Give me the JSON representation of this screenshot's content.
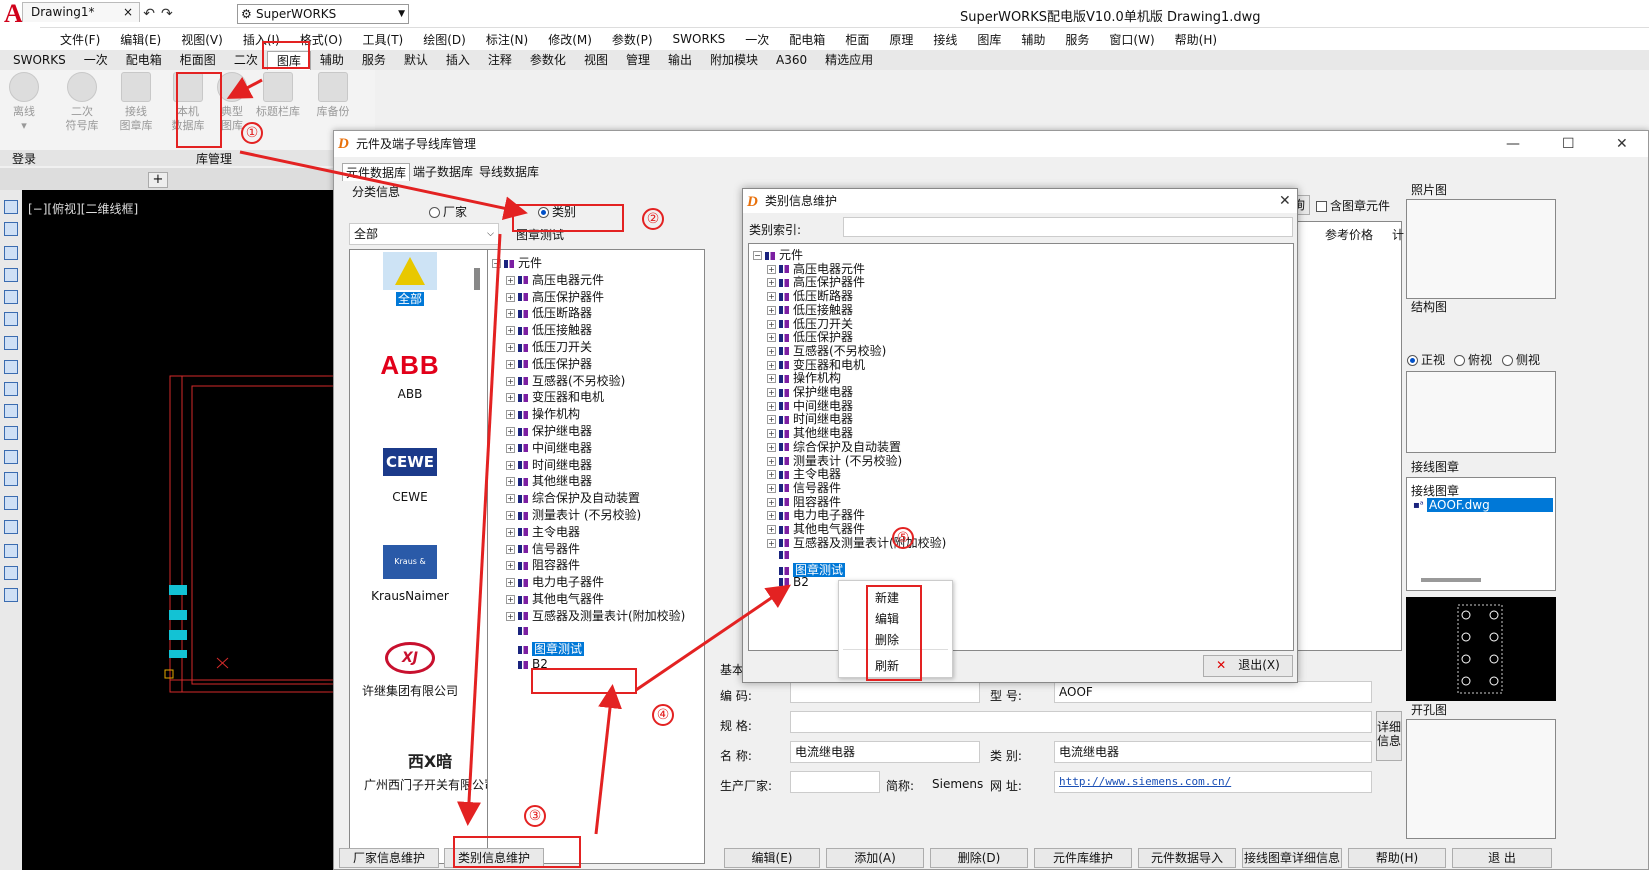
{
  "app": {
    "title": "SuperWORKS配电版V10.0单机版   Drawing1.dwg",
    "workspace": "SuperWORKS",
    "logo_letter": "A"
  },
  "menubar": [
    "文件(F)",
    "编辑(E)",
    "视图(V)",
    "插入(I)",
    "格式(O)",
    "工具(T)",
    "绘图(D)",
    "标注(N)",
    "修改(M)",
    "参数(P)",
    "SWORKS",
    "一次",
    "配电箱",
    "柜面",
    "原理",
    "接线",
    "图库",
    "辅助",
    "服务",
    "窗口(W)",
    "帮助(H)"
  ],
  "ribbon_tabs": [
    {
      "label": "SWORKS",
      "active": false
    },
    {
      "label": "一次",
      "active": false
    },
    {
      "label": "配电箱",
      "active": false
    },
    {
      "label": "柜面图",
      "active": false
    },
    {
      "label": "二次",
      "active": false
    },
    {
      "label": "图库",
      "active": true
    },
    {
      "label": "辅助",
      "active": false
    },
    {
      "label": "服务",
      "active": false
    },
    {
      "label": "默认",
      "active": false
    },
    {
      "label": "插入",
      "active": false
    },
    {
      "label": "注释",
      "active": false
    },
    {
      "label": "参数化",
      "active": false
    },
    {
      "label": "视图",
      "active": false
    },
    {
      "label": "管理",
      "active": false
    },
    {
      "label": "输出",
      "active": false
    },
    {
      "label": "附加模块",
      "active": false
    },
    {
      "label": "A360",
      "active": false
    },
    {
      "label": "精选应用",
      "active": false
    }
  ],
  "ribbon": {
    "offline": "离线",
    "sym1": "二次",
    "sym2": "符号库",
    "wire1": "接线",
    "wire2": "图章库",
    "local1": "本机",
    "local2": "数据库",
    "typical1": "典型",
    "typical2": "图库",
    "titlebar_lib": "标题栏库",
    "backup": "库备份",
    "group_login": "登录",
    "group_lib": "库管理"
  },
  "doc": {
    "tab": "Drawing1*",
    "close": "×",
    "add": "+",
    "view_label": "[−][俯视][二维线框]"
  },
  "dlg1": {
    "title": "元件及端子导线库管理",
    "min": "—",
    "max": "☐",
    "close": "✕",
    "tabs": [
      "元件数据库",
      "端子数据库",
      "导线数据库"
    ],
    "classify_label": "分类信息",
    "radio_vendor": "厂家",
    "radio_category": "类别",
    "filter_all": "全部",
    "current_category": "图章测试",
    "query_btn": "查询",
    "include_stamp": "含图章元件",
    "col_price": "参考价格",
    "col_calc": "计",
    "photo_label": "照片图",
    "struct_label": "结构图",
    "view_front": "正视",
    "view_top": "俯视",
    "view_side": "侧视",
    "stamp_label": "接线图章",
    "stamp_sub": "接线图章",
    "stamp_file": "AOOF.dwg",
    "cut_label": "开孔图",
    "basic_info": "基本信息",
    "code_label": "编  码:",
    "model_label": "型  号:",
    "model_value": "AOOF",
    "spec_label": "规  格:",
    "name_label": "名  称:",
    "name_value": "电流继电器",
    "cat_label": "类  别:",
    "cat_value": "电流继电器",
    "maker_label": "生产厂家:",
    "abbr_label": "简称:",
    "abbr_value": "Siemens",
    "url_label": "网  址:",
    "url_value": "http://www.siemens.com.cn/",
    "detail1": "详细",
    "detail2": "信息",
    "brand_all": "全部",
    "brands": [
      {
        "logo": "ABB",
        "name": "ABB"
      },
      {
        "logo": "CEWE",
        "name": "CEWE"
      },
      {
        "logo": "Kraus & Naimer",
        "name": "KrausNaimer"
      },
      {
        "logo": "XJ",
        "name": "许继集团有限公司"
      },
      {
        "logo": "西X暗",
        "name": "广州西门子开关有限公司"
      }
    ],
    "tree_root": "元件",
    "tree": [
      "高压电器元件",
      "高压保护器件",
      "低压断路器",
      "低压接触器",
      "低压刀开关",
      "低压保护器",
      "互感器(不另校验)",
      "变压器和电机",
      "操作机构",
      "保护继电器",
      "中间继电器",
      "时间继电器",
      "其他继电器",
      "综合保护及自动装置",
      "测量表计 (不另校验)",
      "主令电器",
      "信号器件",
      "阻容器件",
      "电力电子器件",
      "其他电气器件",
      "互感器及测量表计(附加校验)"
    ],
    "tree_stamp": "图章测试",
    "tree_b2": "B2",
    "buttons": [
      "厂家信息维护",
      "类别信息维护",
      "编辑(E)",
      "添加(A)",
      "删除(D)",
      "元件库维护",
      "元件数据导入",
      "接线图章详细信息",
      "帮助(H)",
      "退    出"
    ]
  },
  "dlg2": {
    "title": "类别信息维护",
    "close": "✕",
    "index_label": "类别索引:",
    "tree_root": "元件",
    "tree": [
      "高压电器元件",
      "高压保护器件",
      "低压断路器",
      "低压接触器",
      "低压刀开关",
      "低压保护器",
      "互感器(不另校验)",
      "变压器和电机",
      "操作机构",
      "保护继电器",
      "中间继电器",
      "时间继电器",
      "其他继电器",
      "综合保护及自动装置",
      "测量表计 (不另校验)",
      "主令电器",
      "信号器件",
      "阻容器件",
      "电力电子器件",
      "其他电气器件",
      "互感器及测量表计(附加校验)"
    ],
    "tree_stamp": "图章测试",
    "tree_b2": "B2",
    "exit_btn": "退出(X)"
  },
  "context_menu": [
    "新建",
    "编辑",
    "删除",
    "刷新"
  ],
  "annotations": [
    "①",
    "②",
    "③",
    "④",
    "⑤"
  ],
  "colors": {
    "annotation": "#e32222",
    "selection": "#0078d7"
  }
}
